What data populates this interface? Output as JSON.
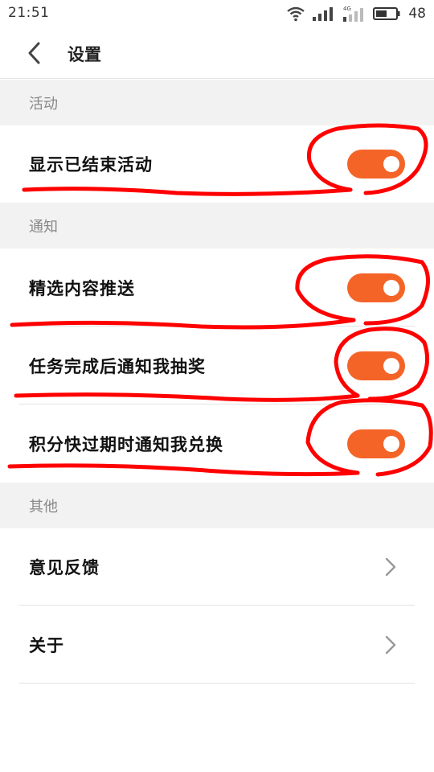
{
  "status_bar": {
    "time": "21:51",
    "network_label": "4G",
    "battery_level": "48",
    "icons": [
      "wifi-icon",
      "signal-icon",
      "signal-4g-icon",
      "battery-icon"
    ]
  },
  "header": {
    "title": "设置",
    "back_icon": "chevron-left-icon"
  },
  "sections": {
    "activity": {
      "title": "活动",
      "items": [
        {
          "label": "显示已结束活动",
          "enabled": true
        }
      ]
    },
    "notifications": {
      "title": "通知",
      "items": [
        {
          "label": "精选内容推送",
          "enabled": true
        },
        {
          "label": "任务完成后通知我抽奖",
          "enabled": true
        },
        {
          "label": "积分快过期时通知我兑换",
          "enabled": true
        }
      ]
    },
    "other": {
      "title": "其他",
      "items": [
        {
          "label": "意见反馈",
          "icon": "chevron-right-icon"
        },
        {
          "label": "关于",
          "icon": "chevron-right-icon"
        }
      ]
    }
  },
  "colors": {
    "toggle_on": "#f46427",
    "section_bg": "#f2f2f2",
    "annotation": "#ff0000"
  }
}
